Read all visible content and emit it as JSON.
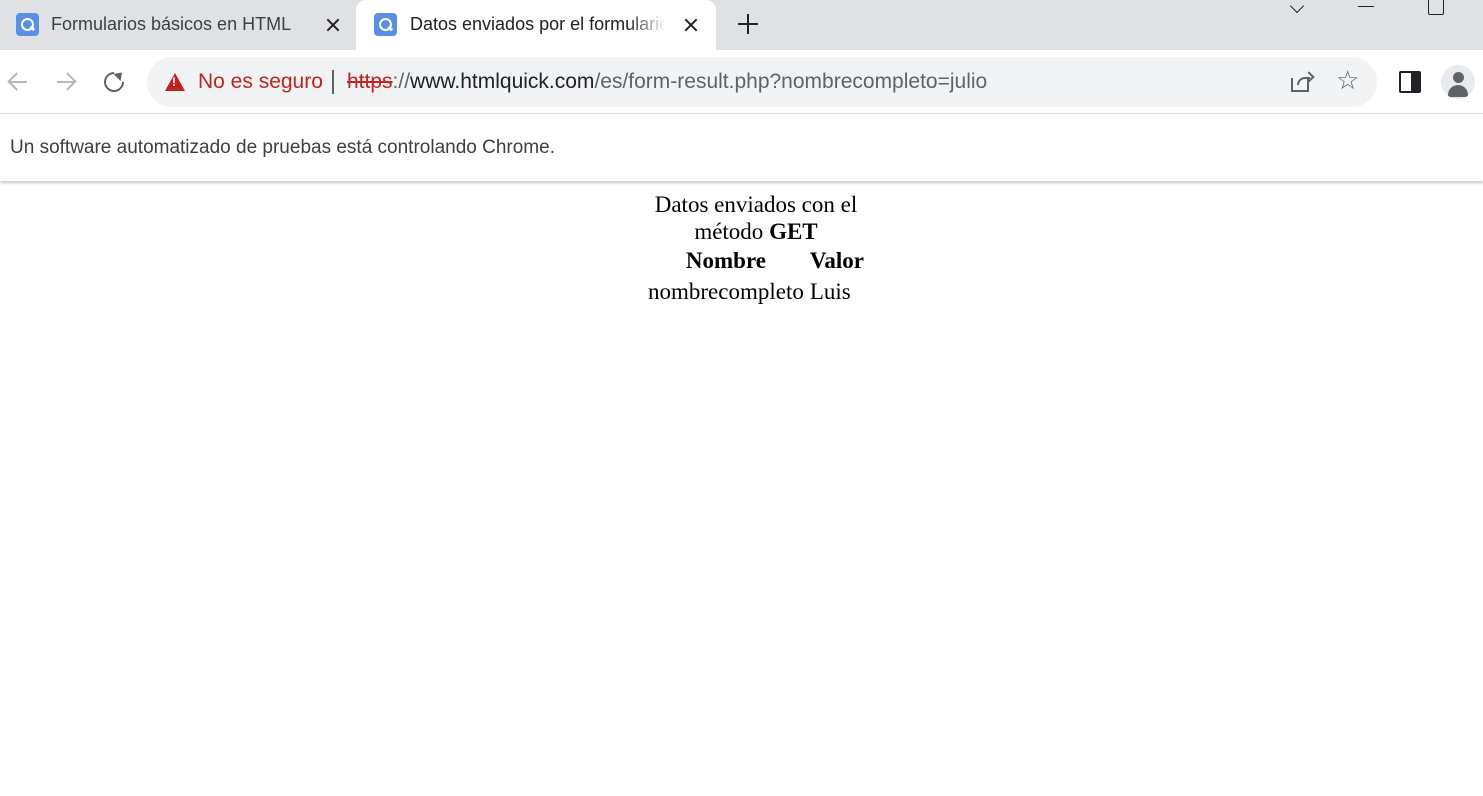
{
  "tabs": [
    {
      "title": "Formularios básicos en HTML"
    },
    {
      "title": "Datos enviados por el formulario"
    }
  ],
  "omnibox": {
    "security_label": "No es seguro",
    "url_scheme": "https",
    "url_sep": "://",
    "url_host": "www.htmlquick.com",
    "url_path": "/es/form-result.php?nombrecompleto=julio"
  },
  "infobar": {
    "message": "Un software automatizado de pruebas está controlando Chrome."
  },
  "page": {
    "caption_line1": "Datos enviados con el",
    "caption_line2_prefix": "método ",
    "caption_method": "GET",
    "headers": [
      "Nombre",
      "Valor"
    ],
    "rows": [
      {
        "name": "nombrecompleto",
        "value": "Luis"
      }
    ]
  },
  "colors": {
    "tabstrip_bg": "#dfe1e5",
    "insecure_red": "#c5221f",
    "omnibox_bg": "#f1f3f4",
    "favicon_blue": "#5a8fe8"
  },
  "icons": [
    "favicon-icon",
    "close-icon",
    "plus-icon",
    "chevron-down-icon",
    "minimize-icon",
    "maximize-icon",
    "back-arrow-icon",
    "forward-arrow-icon",
    "reload-icon",
    "warning-icon",
    "share-icon",
    "star-icon",
    "side-panel-icon",
    "profile-icon"
  ]
}
